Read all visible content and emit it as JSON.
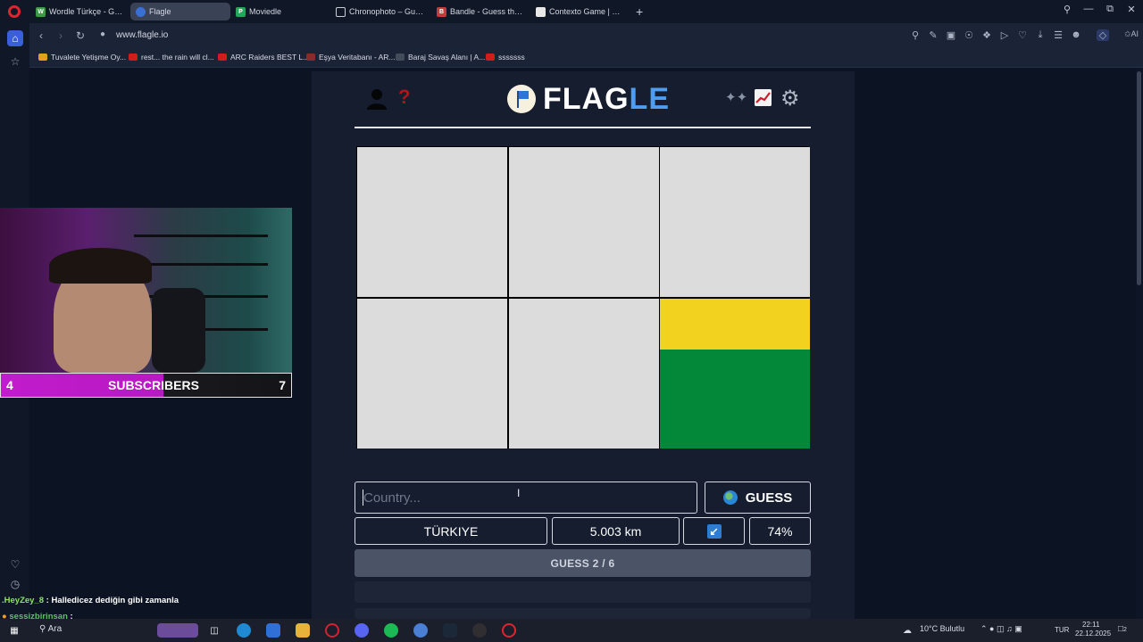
{
  "browser": {
    "tabs": [
      {
        "label": "Wordle Türkçe - Günlük K",
        "icon": "wordle-icon",
        "color": "#3c9a48",
        "active": false
      },
      {
        "label": "Flagle",
        "icon": "flagle-icon",
        "color": "#3a6fd4",
        "active": true
      },
      {
        "label": "Moviedle",
        "icon": "moviedle-icon",
        "color": "#27a35a",
        "active": false
      },
      {
        "label": "Chronophoto – Guess the",
        "icon": "camera-icon",
        "color": "#555d6c",
        "active": false
      },
      {
        "label": "Bandle - Guess the song,",
        "icon": "bandle-icon",
        "color": "#c43b3b",
        "active": false
      },
      {
        "label": "Contexto Game | Contexto",
        "icon": "contexto-icon",
        "color": "#e8e8e8",
        "active": false
      }
    ],
    "new_tab": "+",
    "url": "www.flagle.io",
    "bookmarks": [
      {
        "label": "Tuvalete Yetişme Oy...",
        "color": "#e0a21c"
      },
      {
        "label": "rest... the rain will cl...",
        "color": "#d21c1c"
      },
      {
        "label": "ARC Raiders BEST L...",
        "color": "#d21c1c"
      },
      {
        "label": "Eşya Veritabanı - AR...",
        "color": "#8a2c2c"
      },
      {
        "label": "Baraj Savaş Alanı | A...",
        "color": "#444b5a"
      },
      {
        "label": "sssssss",
        "color": "#d21c1c"
      }
    ]
  },
  "game": {
    "title_main": "FLAG",
    "title_accent": "LE",
    "input_placeholder": "Country...",
    "guess_label": "GUESS",
    "result": {
      "country": "TÜRKIYE",
      "distance": "5.003 km",
      "direction_icon": "arrow-southwest-icon",
      "proximity": "74%"
    },
    "guess_counter": "GUESS 2 / 6",
    "flag_colors": {
      "top": "#f2d21e",
      "bottom": "#03883a",
      "hidden": "#dcdcdc"
    }
  },
  "stream": {
    "sub_left": "4",
    "sub_label": "SUBSCRIBERS",
    "sub_right": "7",
    "chat": [
      {
        "user": ".HeyZey_8",
        "message": ": Halledicez dediğin gibi zamanla",
        "user_color": "#8be36a",
        "text_color": "#ffffff"
      },
      {
        "user": "sessizbirinsan",
        "message": ":",
        "user_color": "#5fc06a",
        "text_color": "#ffffff"
      }
    ]
  },
  "taskbar": {
    "search": "Ara",
    "weather": "10°C  Bulutlu",
    "lang": "TUR",
    "time": "22:11",
    "date": "22.12.2025",
    "notifications": "2"
  }
}
